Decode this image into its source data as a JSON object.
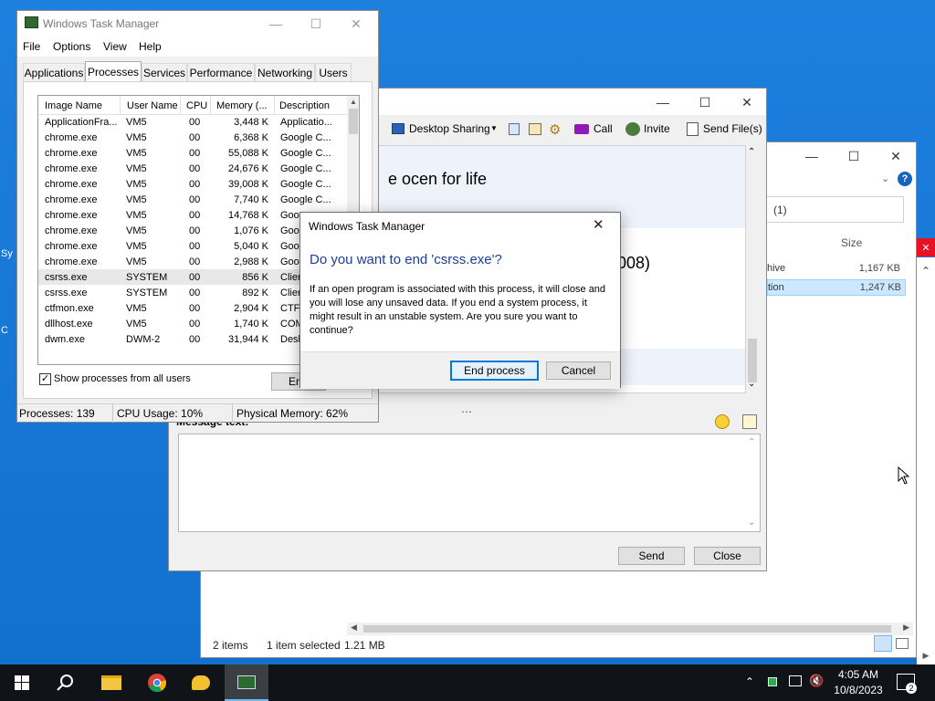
{
  "desktop": {
    "icon_labels": [
      "Sy",
      "C"
    ]
  },
  "explorer": {
    "search_value": "(1)",
    "size_header": "Size",
    "files": [
      {
        "name_fragment": "hive",
        "size": "1,167 KB"
      },
      {
        "name_fragment": "tion",
        "size": "1,247 KB"
      }
    ],
    "status_items": "2 items",
    "status_selected": "1 item selected",
    "status_size": "1.21 MB"
  },
  "chat": {
    "toolbar": {
      "desktop_sharing": "Desktop Sharing",
      "call": "Call",
      "invite": "Invite",
      "send_files": "Send File(s)"
    },
    "conversation_line1": "e ocen for life",
    "conversation_line2": "008)",
    "message_label": "Message text:",
    "message_value": "",
    "send": "Send",
    "close": "Close"
  },
  "taskmanager": {
    "title": "Windows Task Manager",
    "menu": [
      "File",
      "Options",
      "View",
      "Help"
    ],
    "tabs": [
      "Applications",
      "Processes",
      "Services",
      "Performance",
      "Networking",
      "Users"
    ],
    "active_tab": 1,
    "columns": [
      "Image Name",
      "User Name",
      "CPU",
      "Memory (...",
      "Description"
    ],
    "rows": [
      [
        "ApplicationFra...",
        "VM5",
        "00",
        "3,448 K",
        "Applicatio..."
      ],
      [
        "chrome.exe",
        "VM5",
        "00",
        "6,368 K",
        "Google C..."
      ],
      [
        "chrome.exe",
        "VM5",
        "00",
        "55,088 K",
        "Google C..."
      ],
      [
        "chrome.exe",
        "VM5",
        "00",
        "24,676 K",
        "Google C..."
      ],
      [
        "chrome.exe",
        "VM5",
        "00",
        "39,008 K",
        "Google C..."
      ],
      [
        "chrome.exe",
        "VM5",
        "00",
        "7,740 K",
        "Google C..."
      ],
      [
        "chrome.exe",
        "VM5",
        "00",
        "14,768 K",
        "Goog"
      ],
      [
        "chrome.exe",
        "VM5",
        "00",
        "1,076 K",
        "Goog"
      ],
      [
        "chrome.exe",
        "VM5",
        "00",
        "5,040 K",
        "Goog"
      ],
      [
        "chrome.exe",
        "VM5",
        "00",
        "2,988 K",
        "Goog"
      ],
      [
        "csrss.exe",
        "SYSTEM",
        "00",
        "856 K",
        "Clien"
      ],
      [
        "csrss.exe",
        "SYSTEM",
        "00",
        "892 K",
        "Clien"
      ],
      [
        "ctfmon.exe",
        "VM5",
        "00",
        "2,904 K",
        "CTF"
      ],
      [
        "dllhost.exe",
        "VM5",
        "00",
        "1,740 K",
        "COM"
      ],
      [
        "dwm.exe",
        "DWM-2",
        "00",
        "31,944 K",
        "Desk"
      ]
    ],
    "selected_row": 10,
    "show_all_label": "Show processes from all users",
    "end_button": "End",
    "status_processes": "Processes: 139",
    "status_cpu": "CPU Usage: 10%",
    "status_memory": "Physical Memory: 62%"
  },
  "dialog": {
    "title": "Windows Task Manager",
    "heading": "Do you want to end 'csrss.exe'?",
    "body": "If an open program is associated with this process, it will close and you will lose any unsaved data. If you end a system process, it might result in an unstable system. Are you sure you want to continue?",
    "end_process": "End process",
    "cancel": "Cancel"
  },
  "taskbar": {
    "time": "4:05 AM",
    "date": "10/8/2023",
    "notification_count": "2"
  },
  "colors": {
    "accent": "#0078d7",
    "dialog_heading": "#1a3e9a",
    "desktop": "#1377d6",
    "taskbar": "#101418"
  }
}
